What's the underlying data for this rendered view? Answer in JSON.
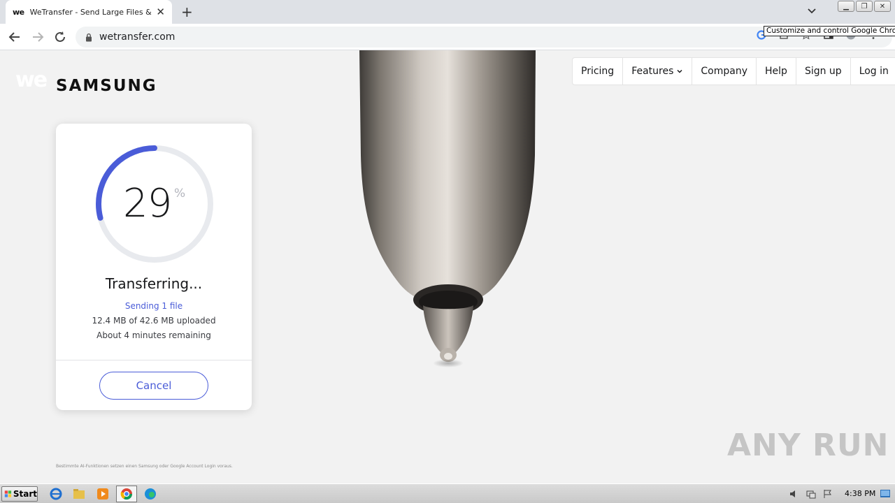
{
  "browser": {
    "tab_favicon": "we",
    "tab_title": "WeTransfer - Send Large Files & Sha",
    "url": "wetransfer.com",
    "tooltip": "Customize and control Google Chrome",
    "icons": [
      "back-icon",
      "forward-icon",
      "reload-icon",
      "lock-icon",
      "google-icon",
      "share-icon",
      "star-icon",
      "sidepanel-icon",
      "profile-icon",
      "menu-icon"
    ]
  },
  "brand": {
    "we_logo": "we",
    "samsung_logo": "SAMSUNG"
  },
  "nav": {
    "items": [
      {
        "label": "Pricing"
      },
      {
        "label": "Features"
      },
      {
        "label": "Company"
      },
      {
        "label": "Help"
      },
      {
        "label": "Sign up"
      },
      {
        "label": "Log in"
      }
    ]
  },
  "transfer": {
    "progress": 29,
    "percent_sign": "%",
    "title": "Transferring...",
    "status": "Sending 1 file",
    "uploaded": "12.4 MB of 42.6 MB uploaded",
    "remaining": "About 4 minutes remaining",
    "cancel_label": "Cancel",
    "accent": "#4a5cd8"
  },
  "footnote": "Bestimmte AI-Funktionen setzen einen Samsung oder Google Account Login voraus.",
  "watermark": "ANY RUN",
  "taskbar": {
    "start_label": "Start",
    "clock": "4:38 PM",
    "icons": [
      "ie-icon",
      "explorer-icon",
      "media-player-icon",
      "chrome-icon",
      "edge-icon"
    ]
  }
}
